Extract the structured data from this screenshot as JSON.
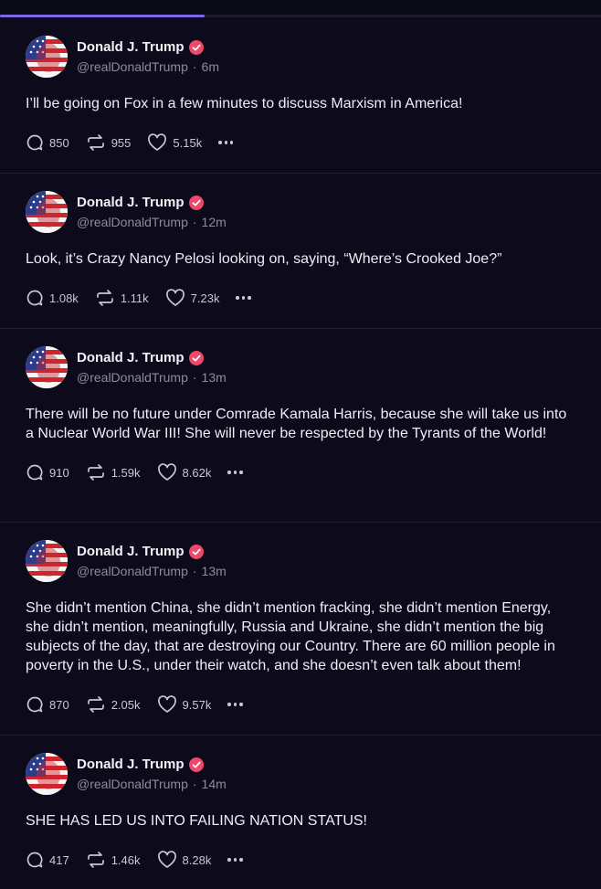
{
  "colors": {
    "background": "#0d0b1b",
    "tab_indicator": "#7a67e8",
    "verified_badge": "#f0476a",
    "muted_text": "#8d8aa3"
  },
  "posts": [
    {
      "name": "Donald J. Trump",
      "handle": "@realDonaldTrump",
      "time": "6m",
      "text": "I’ll be going on Fox in a few minutes to discuss Marxism in America!",
      "replies": "850",
      "reposts": "955",
      "likes": "5.15k"
    },
    {
      "name": "Donald J. Trump",
      "handle": "@realDonaldTrump",
      "time": "12m",
      "text": "Look, it’s Crazy Nancy Pelosi looking on, saying, “Where’s Crooked Joe?”",
      "replies": "1.08k",
      "reposts": "1.11k",
      "likes": "7.23k"
    },
    {
      "name": "Donald J. Trump",
      "handle": "@realDonaldTrump",
      "time": "13m",
      "text": "There will be no future under Comrade Kamala Harris, because she will take us into a Nuclear World War III! She will never be respected by the Tyrants of the World!",
      "replies": "910",
      "reposts": "1.59k",
      "likes": "8.62k"
    },
    {
      "name": "Donald J. Trump",
      "handle": "@realDonaldTrump",
      "time": "13m",
      "text": "She didn’t mention China, she didn’t mention fracking, she didn’t mention Energy, she didn’t mention, meaningfully, Russia and Ukraine, she didn’t mention the big subjects of the day, that are destroying our Country. There are 60 million people in poverty in the U.S., under their watch, and she doesn’t even talk about them!",
      "replies": "870",
      "reposts": "2.05k",
      "likes": "9.57k"
    },
    {
      "name": "Donald J. Trump",
      "handle": "@realDonaldTrump",
      "time": "14m",
      "text": "SHE HAS LED US INTO FAILING NATION STATUS!",
      "replies": "417",
      "reposts": "1.46k",
      "likes": "8.28k"
    }
  ]
}
